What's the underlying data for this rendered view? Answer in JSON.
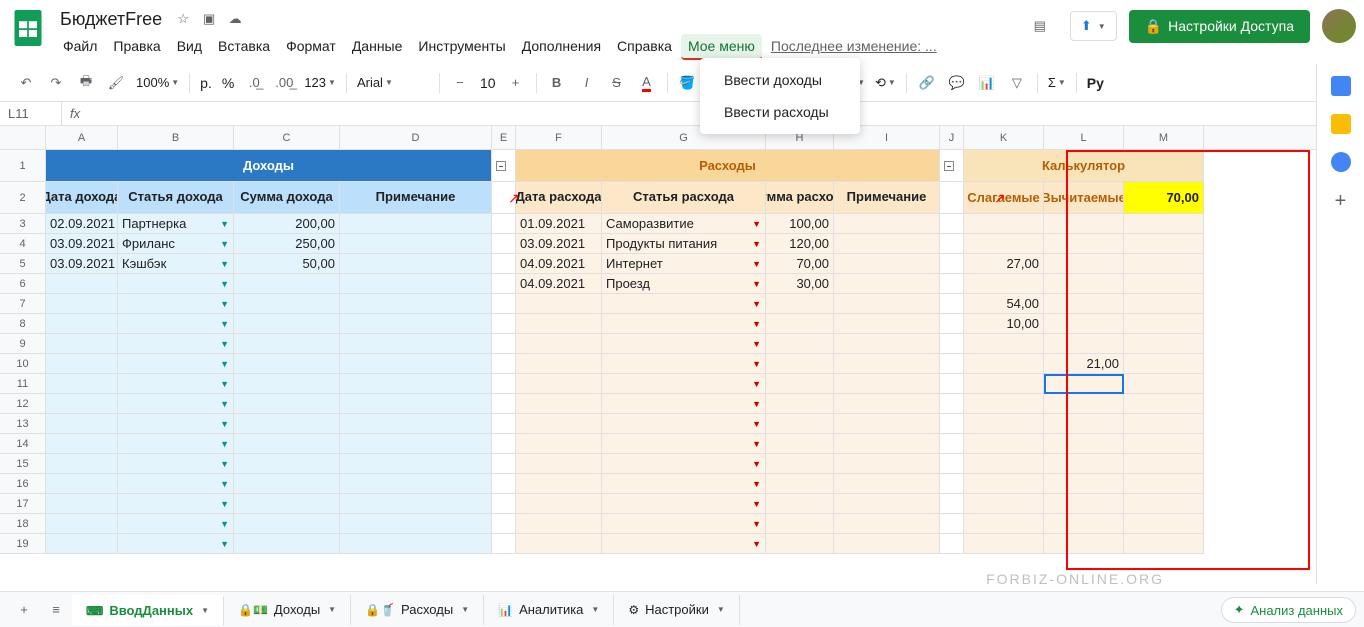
{
  "doc_title": "БюджетFree",
  "menus": [
    "Файл",
    "Правка",
    "Вид",
    "Вставка",
    "Формат",
    "Данные",
    "Инструменты",
    "Дополнения",
    "Справка",
    "Мое меню"
  ],
  "last_edit": "Последнее изменение: ...",
  "share_label": "Настройки Доступа",
  "zoom": "100%",
  "font": "Arial",
  "font_size": "10",
  "namebox": "L11",
  "dropdown": {
    "items": [
      "Ввести доходы",
      "Ввести расходы"
    ]
  },
  "cols": {
    "A": 72,
    "B": 116,
    "C": 106,
    "D": 152,
    "E": 24,
    "F": 86,
    "G": 164,
    "H": 68,
    "I": 106,
    "J": 24,
    "K": 80,
    "L": 80,
    "M": 80
  },
  "income": {
    "title": "Доходы",
    "headers": [
      "Дата дохода",
      "Статья дохода",
      "Сумма дохода",
      "Примечание"
    ],
    "rows": [
      {
        "date": "02.09.2021",
        "item": "Партнерка",
        "sum": "200,00",
        "note": ""
      },
      {
        "date": "03.09.2021",
        "item": "Фриланс",
        "sum": "250,00",
        "note": ""
      },
      {
        "date": "03.09.2021",
        "item": "Кэшбэк",
        "sum": "50,00",
        "note": ""
      }
    ]
  },
  "expense": {
    "title": "Расходы",
    "headers": [
      "Дата расхода",
      "Статья расхода",
      "Сумма расхода",
      "Примечание"
    ],
    "rows": [
      {
        "date": "01.09.2021",
        "item": "Саморазвитие",
        "sum": "100,00",
        "note": ""
      },
      {
        "date": "03.09.2021",
        "item": "Продукты питания",
        "sum": "120,00",
        "note": ""
      },
      {
        "date": "04.09.2021",
        "item": "Интернет",
        "sum": "70,00",
        "note": ""
      },
      {
        "date": "04.09.2021",
        "item": "Проезд",
        "sum": "30,00",
        "note": ""
      }
    ]
  },
  "calc": {
    "title": "Калькулятор",
    "headers": [
      "Слагаемые",
      "Вычитаемые"
    ],
    "result": "70,00",
    "rows": [
      {
        "a": "",
        "b": ""
      },
      {
        "a": "",
        "b": ""
      },
      {
        "a": "27,00",
        "b": ""
      },
      {
        "a": "",
        "b": ""
      },
      {
        "a": "54,00",
        "b": ""
      },
      {
        "a": "10,00",
        "b": ""
      },
      {
        "a": "",
        "b": ""
      },
      {
        "a": "",
        "b": "21,00"
      },
      {
        "a": "",
        "b": ""
      },
      {
        "a": "",
        "b": ""
      },
      {
        "a": "",
        "b": ""
      },
      {
        "a": "",
        "b": ""
      },
      {
        "a": "",
        "b": ""
      },
      {
        "a": "",
        "b": ""
      },
      {
        "a": "",
        "b": ""
      },
      {
        "a": "",
        "b": ""
      },
      {
        "a": "",
        "b": ""
      }
    ]
  },
  "tabs": [
    {
      "label": "ВводДанных",
      "icon": "⌨",
      "active": true
    },
    {
      "label": "Доходы",
      "icon": "🔒💵",
      "active": false
    },
    {
      "label": "Расходы",
      "icon": "🔒🥤",
      "active": false
    },
    {
      "label": "Аналитика",
      "icon": "📊",
      "active": false
    },
    {
      "label": "Настройки",
      "icon": "⚙",
      "active": false
    }
  ],
  "explore": "Анализ данных",
  "watermark": "FORBIZ-ONLINE.ORG",
  "row_count": 19
}
